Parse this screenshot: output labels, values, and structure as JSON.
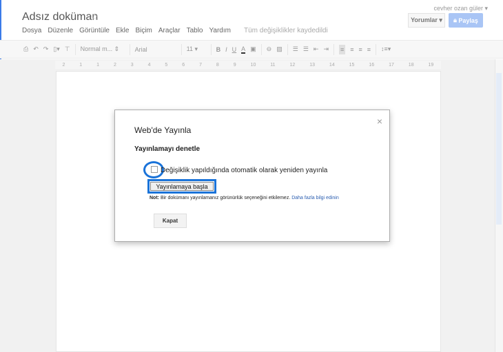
{
  "user": "cevher ozan güler ▾",
  "doc_title": "Adsız doküman",
  "menu": [
    "Dosya",
    "Düzenle",
    "Görüntüle",
    "Ekle",
    "Biçim",
    "Araçlar",
    "Tablo",
    "Yardım"
  ],
  "saved_status": "Tüm değişiklikler kaydedildi",
  "comments_label": "Yorumlar ▾",
  "share_label": "Paylaş",
  "toolbar": {
    "style": "Normal m... ⇕",
    "font": "Arial",
    "size": "11 ▾"
  },
  "ruler": [
    "2",
    "1",
    "1",
    "2",
    "3",
    "4",
    "5",
    "6",
    "7",
    "8",
    "9",
    "10",
    "11",
    "12",
    "13",
    "14",
    "15",
    "16",
    "17",
    "18",
    "19"
  ],
  "dialog": {
    "title": "Web'de Yayınla",
    "subtitle": "Yayınlamayı denetle",
    "checkbox_label": "Değişiklik yapıldığında otomatik olarak yeniden yayınla",
    "checkbox_checked": false,
    "start_button": "Yayınlamaya başla",
    "note_bold": "Not:",
    "note_text": " Bir dokümanı yayınlamanız görünürlük seçeneğini etkilemez. ",
    "note_link": "Daha fazla bilgi edinin",
    "close_button": "Kapat",
    "close_icon": "×"
  },
  "colors": {
    "accent": "#1a73d9",
    "share": "#9cbcf3"
  }
}
